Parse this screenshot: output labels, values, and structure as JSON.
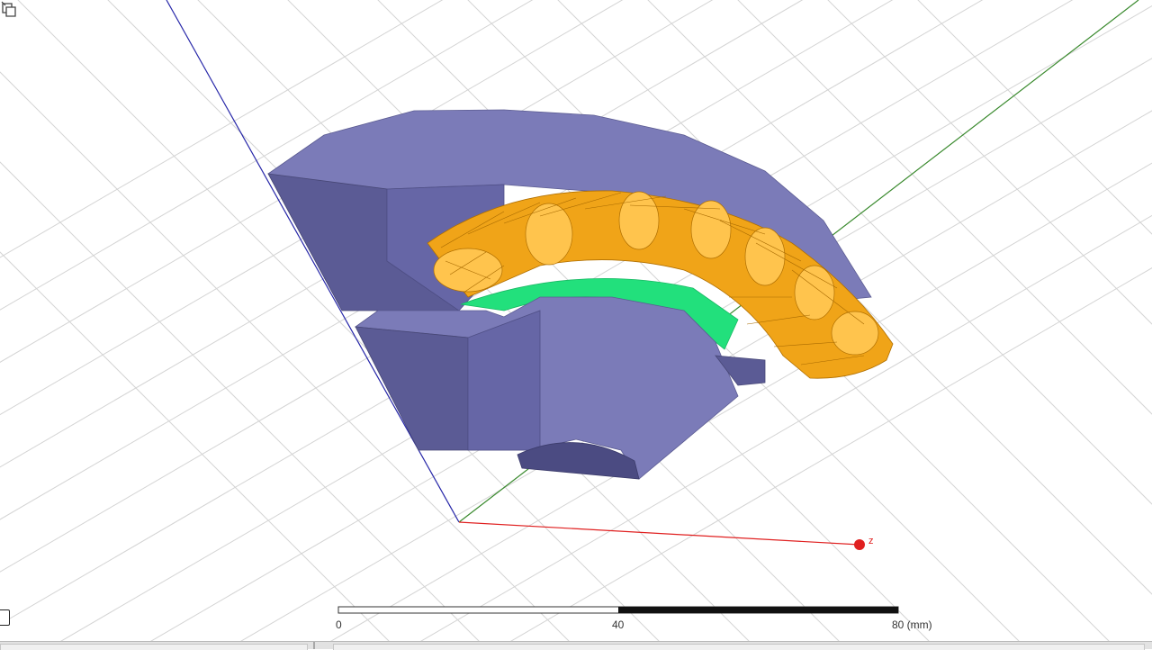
{
  "viewport": {
    "scale_ruler": {
      "ticks": [
        "0",
        "40",
        "80 (mm)"
      ]
    },
    "axes": {
      "z_label": "z"
    },
    "colors": {
      "background": "#ffffff",
      "grid": "#d4d4d4",
      "x_axis": "#3a8a2e",
      "y_axis": "#2626a8",
      "z_axis": "#e02020",
      "iron_core": "#7b7bb8",
      "winding": "#f0a418",
      "magnet": "#22e07c"
    },
    "icons": {
      "orient_cursor": "rotate-cursor-icon",
      "nav_button": "view-toggle-icon"
    }
  }
}
